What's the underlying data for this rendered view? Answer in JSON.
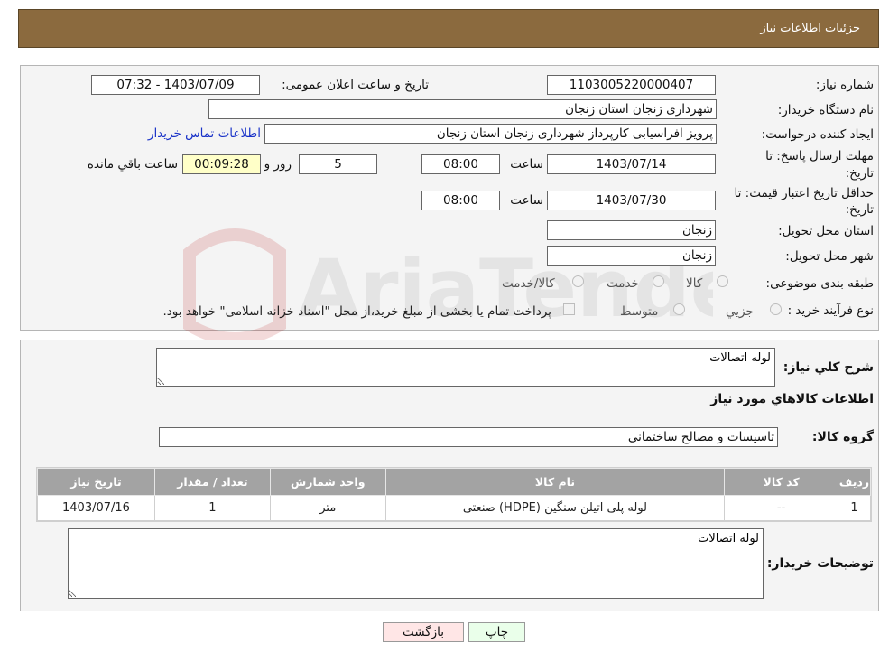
{
  "header": {
    "title": "جزئیات اطلاعات نیاز"
  },
  "details": {
    "need_number_label": "شماره نیاز:",
    "need_number": "1103005220000407",
    "announce_label": "تاریخ و ساعت اعلان عمومی:",
    "announce_value": "1403/07/09 - 07:32",
    "buyer_label": "نام دستگاه خریدار:",
    "buyer_value": "شهرداری زنجان استان زنجان",
    "creator_label": "ایجاد کننده درخواست:",
    "creator_value": "پرویز افراسیابی کارپرداز شهرداری زنجان استان زنجان",
    "contact_link": "اطلاعات تماس خریدار",
    "deadline_label_1": "مهلت ارسال پاسخ: تا",
    "deadline_label_2": "تاریخ:",
    "deadline_date": "1403/07/14",
    "hour_label": "ساعت",
    "deadline_time": "08:00",
    "days_value": "5",
    "days_label": "روز و",
    "remaining_value": "00:09:28",
    "remaining_label": "ساعت باقي مانده",
    "validity_label_1": "حداقل تاریخ اعتبار قیمت: تا",
    "validity_label_2": "تاریخ:",
    "validity_date": "1403/07/30",
    "validity_time": "08:00",
    "province_label": "استان محل تحویل:",
    "province_value": "زنجان",
    "city_label": "شهر محل تحویل:",
    "city_value": "زنجان",
    "category_label": "طبقه بندی موضوعی:",
    "category_options": [
      "کالا",
      "خدمت",
      "کالا/خدمت"
    ],
    "process_label": "نوع فرآیند خرید :",
    "process_options": [
      "جزیي",
      "متوسط"
    ],
    "payment_note": "پرداخت تمام یا بخشی از مبلغ خرید،از محل \"اسناد خزانه اسلامی\" خواهد بود."
  },
  "summary": {
    "description_label": "شرح کلي نياز:",
    "description_value": "لوله اتصالات",
    "goods_info_title": "اطلاعات کالاهاي مورد نياز",
    "group_label": "گروه کالا:",
    "group_value": "تاسیسات و مصالح ساختمانی"
  },
  "table": {
    "headers": [
      "رديف",
      "کد کالا",
      "نام کالا",
      "واحد شمارش",
      "تعداد / مقدار",
      "تاريخ نياز"
    ],
    "rows": [
      [
        "1",
        "--",
        "لوله پلی اتیلن سنگین (HDPE) صنعتی",
        "متر",
        "1",
        "1403/07/16"
      ]
    ]
  },
  "buyer_notes": {
    "label": "توضیحات خریدار:",
    "value": "لوله اتصالات"
  },
  "buttons": {
    "print": "چاپ",
    "back": "بازگشت"
  },
  "watermark": {
    "text": "AriaTender.neT"
  },
  "colors": {
    "header_bg": "#8b6a3e",
    "table_header_bg": "#a3a3a3",
    "link": "#1a33c8",
    "remaining_bg": "#ffffc8",
    "print_btn_bg": "#eaffea",
    "back_btn_bg": "#ffe6e6"
  }
}
